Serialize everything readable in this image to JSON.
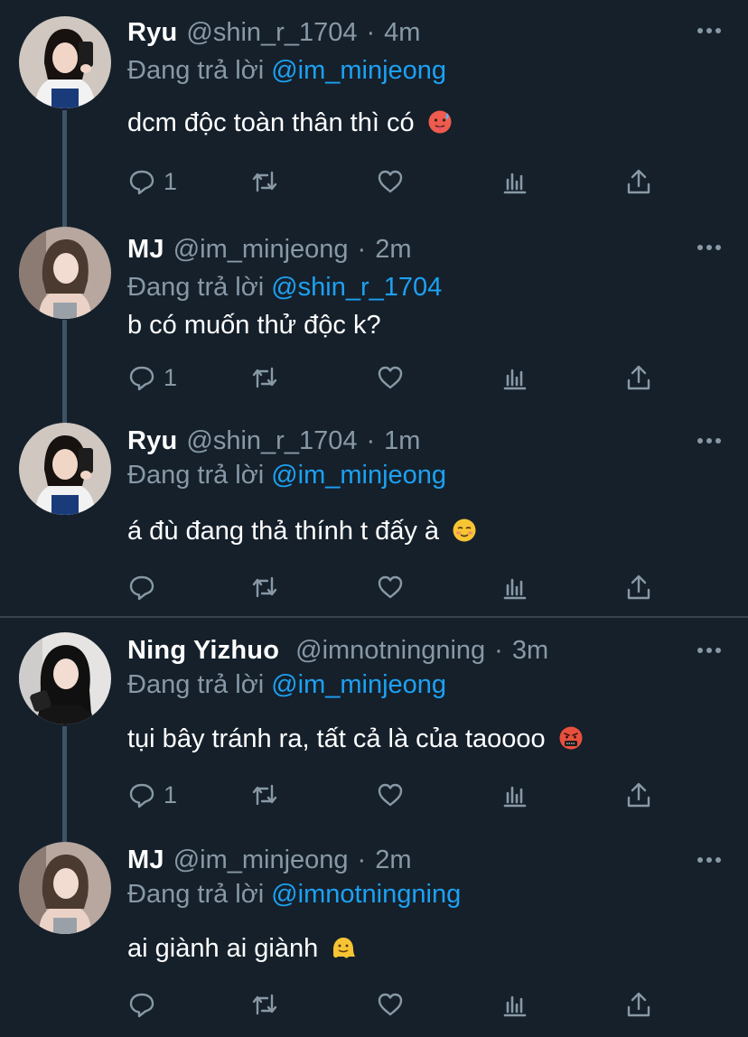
{
  "colors": {
    "background": "#15202b",
    "text": "#ffffff",
    "muted": "#8899a6",
    "link": "#1da1f2",
    "divider": "#38444d",
    "thread_line": "#3d5466"
  },
  "replying_prefix": "Đang trả lời",
  "tweets": [
    {
      "name": "Ryu",
      "handle": "@shin_r_1704",
      "separator": "·",
      "time": "4m",
      "replying_to": "@im_minjeong",
      "text": "dcm độc toàn thân thì có",
      "emoji": "face-with-tongue-sweat-icon",
      "reply_count": "1"
    },
    {
      "name": "MJ",
      "handle": "@im_minjeong",
      "separator": "·",
      "time": "2m",
      "replying_to": "@shin_r_1704",
      "text": "b có muốn thử độc k?",
      "emoji": "",
      "reply_count": "1"
    },
    {
      "name": "Ryu",
      "handle": "@shin_r_1704",
      "separator": "·",
      "time": "1m",
      "replying_to": "@im_minjeong",
      "text": "á đù đang thả thính t đấy à",
      "emoji": "smiling-blushing-face-icon",
      "reply_count": ""
    },
    {
      "name": "Ning Yizhuo",
      "handle": "@imnotningning",
      "separator": "·",
      "time": "3m",
      "replying_to": "@im_minjeong",
      "text": "tụi bây tránh ra, tất cả là của taoooo",
      "emoji": "cursing-face-icon",
      "reply_count": "1"
    },
    {
      "name": "MJ",
      "handle": "@im_minjeong",
      "separator": "·",
      "time": "2m",
      "replying_to": "@imnotningning",
      "text": "ai giành ai giành",
      "emoji": "melting-face-icon",
      "reply_count": ""
    }
  ]
}
